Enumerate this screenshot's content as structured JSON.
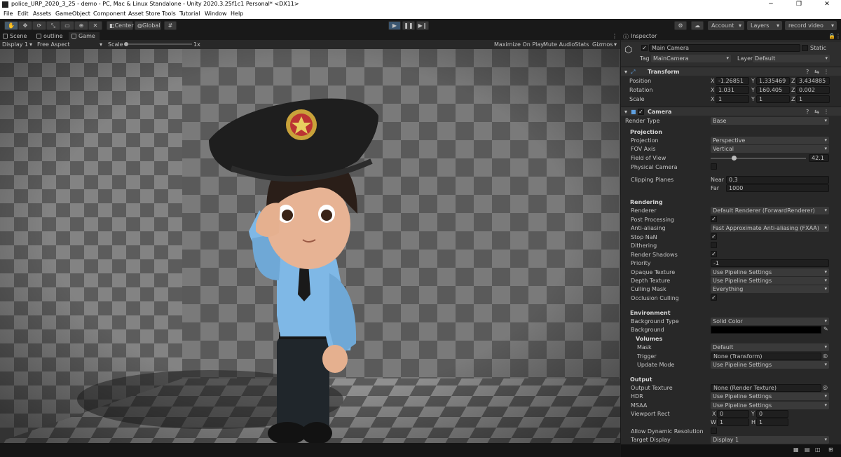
{
  "window": {
    "title": "police_URP_2020_3_25 - demo - PC, Mac & Linux Standalone - Unity 2020.3.25f1c1 Personal* <DX11>"
  },
  "menu": [
    "File",
    "Edit",
    "Assets",
    "GameObject",
    "Component",
    "Asset Store Tools",
    "Tutorial",
    "Window",
    "Help"
  ],
  "toolbar": {
    "center": "Center",
    "global": "Global",
    "account": "Account",
    "layers": "Layers",
    "layout": "record video"
  },
  "tabs": {
    "scene": "Scene",
    "outline": "outline",
    "game": "Game",
    "inspector": "Inspector"
  },
  "gamebar": {
    "display": "Display 1",
    "aspect": "Free Aspect",
    "scale_label": "Scale",
    "scale_value": "1x",
    "maximize": "Maximize On Play",
    "mute": "Mute Audio",
    "stats": "Stats",
    "gizmos": "Gizmos"
  },
  "inspector": {
    "object_name": "Main Camera",
    "static": "Static",
    "tag_label": "Tag",
    "tag_value": "MainCamera",
    "layer_label": "Layer",
    "layer_value": "Default",
    "transform": {
      "title": "Transform",
      "position_label": "Position",
      "position": {
        "x": "-1.26851",
        "y": "1.335469",
        "z": "3.434885"
      },
      "rotation_label": "Rotation",
      "rotation": {
        "x": "1.031",
        "y": "160.405",
        "z": "0.002"
      },
      "scale_label": "Scale",
      "scale": {
        "x": "1",
        "y": "1",
        "z": "1"
      }
    },
    "camera": {
      "title": "Camera",
      "render_type_label": "Render Type",
      "render_type": "Base",
      "projection_section": "Projection",
      "projection_label": "Projection",
      "projection": "Perspective",
      "fov_axis_label": "FOV Axis",
      "fov_axis": "Vertical",
      "fov_label": "Field of View",
      "fov": "42.1",
      "fov_fraction": 0.24,
      "physical_label": "Physical Camera",
      "clipping_label": "Clipping Planes",
      "near_label": "Near",
      "near": "0.3",
      "far_label": "Far",
      "far": "1000",
      "rendering_section": "Rendering",
      "renderer_label": "Renderer",
      "renderer": "Default Renderer (ForwardRenderer)",
      "post_label": "Post Processing",
      "aa_label": "Anti-aliasing",
      "aa": "Fast Approximate Anti-aliasing (FXAA)",
      "stopnan_label": "Stop NaN",
      "dither_label": "Dithering",
      "shadows_label": "Render Shadows",
      "priority_label": "Priority",
      "priority": "-1",
      "opaque_label": "Opaque Texture",
      "opaque": "Use Pipeline Settings",
      "depth_label": "Depth Texture",
      "depth": "Use Pipeline Settings",
      "culling_label": "Culling Mask",
      "culling": "Everything",
      "occlusion_label": "Occlusion Culling",
      "environment_section": "Environment",
      "bgtype_label": "Background Type",
      "bgtype": "Solid Color",
      "bg_label": "Background",
      "volumes_label": "Volumes",
      "mask_label": "Mask",
      "mask": "Default",
      "trigger_label": "Trigger",
      "trigger": "None (Transform)",
      "update_label": "Update Mode",
      "update": "Use Pipeline Settings",
      "output_section": "Output",
      "outtex_label": "Output Texture",
      "outtex": "None (Render Texture)",
      "hdr_label": "HDR",
      "hdr": "Use Pipeline Settings",
      "msaa_label": "MSAA",
      "msaa": "Use Pipeline Settings",
      "vprect_label": "Viewport Rect",
      "vp": {
        "x": "0",
        "y": "0",
        "w": "1",
        "h": "1"
      },
      "dynres_label": "Allow Dynamic Resolution",
      "target_label": "Target Display",
      "target": "Display 1"
    }
  },
  "colors": {
    "accent": "#465a6a",
    "shirt": "#7fb8e6",
    "hat": "#1e1e1e"
  }
}
